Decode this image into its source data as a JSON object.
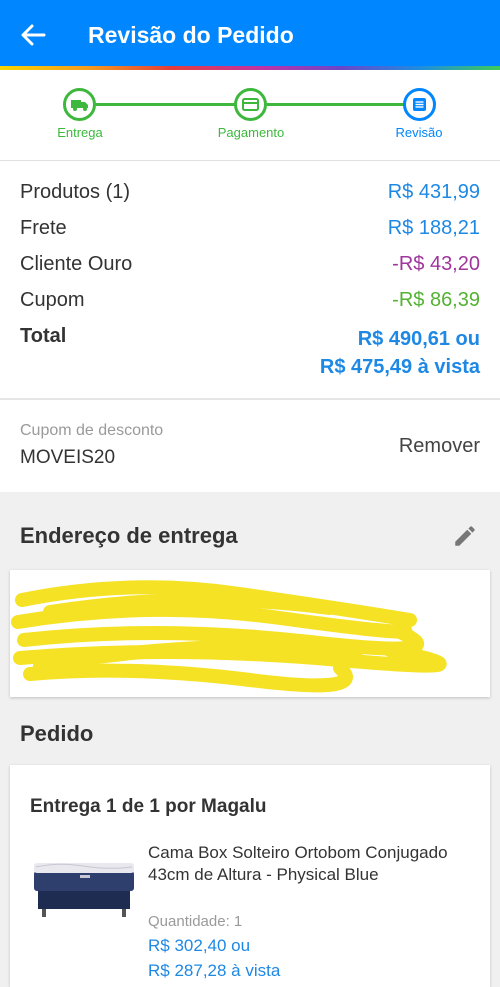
{
  "header": {
    "title": "Revisão do Pedido"
  },
  "steps": [
    {
      "label": "Entrega",
      "icon": "truck-icon"
    },
    {
      "label": "Pagamento",
      "icon": "card-icon"
    },
    {
      "label": "Revisão",
      "icon": "list-icon"
    }
  ],
  "summary": {
    "produtos_label": "Produtos (1)",
    "produtos_value": "R$ 431,99",
    "frete_label": "Frete",
    "frete_value": "R$ 188,21",
    "cliente_label": "Cliente Ouro",
    "cliente_value": "-R$ 43,20",
    "cupom_label": "Cupom",
    "cupom_value": "-R$ 86,39",
    "total_label": "Total",
    "total_value1": "R$ 490,61 ou",
    "total_value2": "R$ 475,49 à vista"
  },
  "coupon": {
    "placeholder": "Cupom de desconto",
    "code": "MOVEIS20",
    "remove_label": "Remover"
  },
  "address": {
    "title": "Endereço de entrega"
  },
  "order": {
    "title": "Pedido",
    "delivery": "Entrega 1 de 1 por Magalu",
    "product_name": "Cama Box Solteiro Ortobom Conjugado 43cm de Altura - Physical Blue",
    "quantity": "Quantidade:  1",
    "price": "R$ 302,40 ou",
    "price_cash": "R$ 287,28 à vista"
  },
  "colors": {
    "primary": "#0086ff",
    "step_done": "#3db83d",
    "price": "#1e88e5",
    "discount_gold": "#a0359a",
    "discount_coupon": "#53b233",
    "redaction": "#f5e11a"
  }
}
